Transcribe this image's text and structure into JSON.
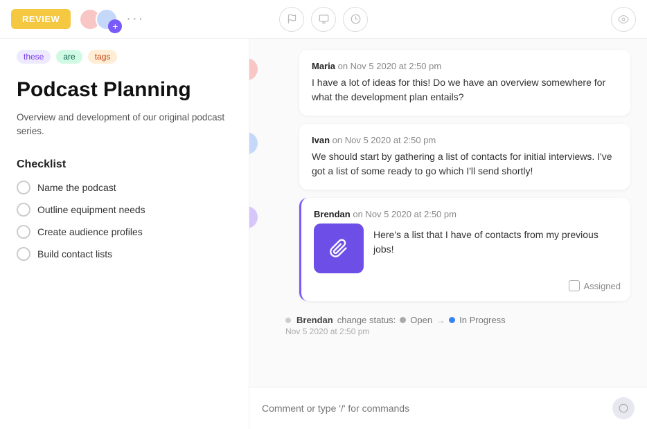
{
  "topbar": {
    "review_label": "REVIEW",
    "more_dots": "···",
    "toolbar_icons": [
      "flag",
      "card",
      "clock"
    ],
    "eye_icon": "👁"
  },
  "tags": [
    {
      "label": "these",
      "style": "purple"
    },
    {
      "label": "are",
      "style": "green"
    },
    {
      "label": "tags",
      "style": "orange"
    }
  ],
  "page": {
    "title": "Podcast Planning",
    "description": "Overview and development of our original podcast series."
  },
  "checklist": {
    "title": "Checklist",
    "items": [
      {
        "label": "Name the podcast"
      },
      {
        "label": "Outline equipment needs"
      },
      {
        "label": "Create audience profiles"
      },
      {
        "label": "Build contact lists"
      }
    ]
  },
  "comments": [
    {
      "author": "Maria",
      "timestamp": "on Nov 5 2020 at 2:50 pm",
      "text": "I have a lot of ideas for this! Do we have an overview somewhere for what the development plan entails?",
      "avatar_color": "pink",
      "highlighted": false
    },
    {
      "author": "Ivan",
      "timestamp": "on Nov 5 2020 at 2:50 pm",
      "text": "We should start by gathering a list of contacts for initial interviews. I've got a list of some ready to go which I'll send shortly!",
      "avatar_color": "blue",
      "highlighted": false
    },
    {
      "author": "Brendan",
      "timestamp": "on Nov 5 2020 at 2:50 pm",
      "text": "Here's a list that I have of contacts from my previous jobs!",
      "avatar_color": "purple",
      "has_attachment": true,
      "assigned_label": "Assigned",
      "highlighted": true
    }
  ],
  "status_change": {
    "author": "Brendan",
    "label": "change status:",
    "from": "Open",
    "arrow": "→",
    "to": "In Progress",
    "timestamp": "Nov 5 2020 at 2:50 pm"
  },
  "comment_input": {
    "placeholder": "Comment or type '/' for commands"
  }
}
